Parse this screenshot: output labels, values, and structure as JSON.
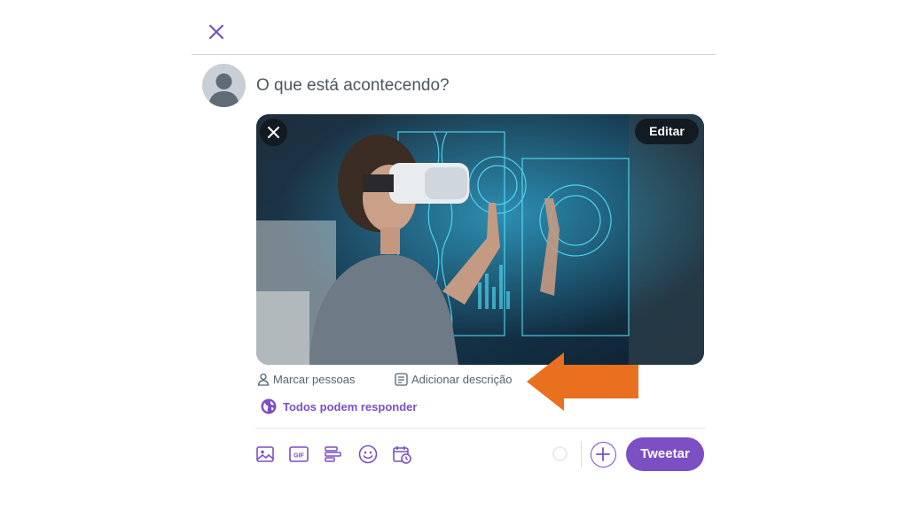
{
  "composer": {
    "placeholder": "O que está acontecendo?"
  },
  "media": {
    "edit_label": "Editar",
    "tag_people_label": "Marcar pessoas",
    "add_description_label": "Adicionar descrição"
  },
  "reply_setting": {
    "label": "Todos podem responder"
  },
  "toolbar": {
    "icons": [
      "image-icon",
      "gif-icon",
      "poll-icon",
      "emoji-icon",
      "schedule-icon"
    ],
    "gif_text": "GIF",
    "tweet_label": "Tweetar"
  },
  "colors": {
    "accent": "#7c4fc4",
    "annotation_arrow": "#e8701e"
  }
}
